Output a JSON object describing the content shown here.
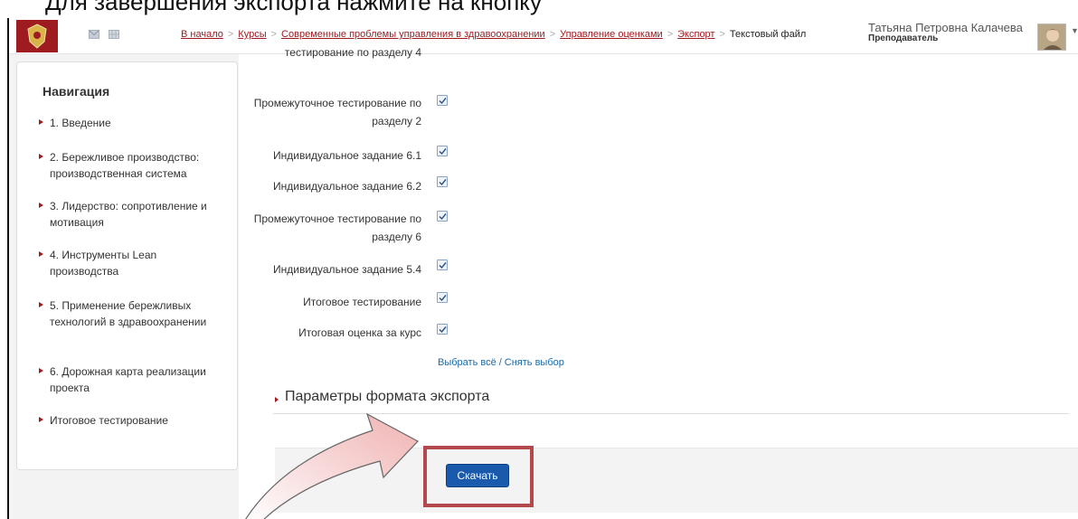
{
  "top_caption": "Для завершения экспорта нажмите на кнопку",
  "navbar": {
    "breadcrumb": [
      {
        "label": "В начало",
        "link": true
      },
      {
        "label": "Курсы",
        "link": true
      },
      {
        "label": "Современные проблемы управления в здравоохранении",
        "link": true
      },
      {
        "label": "Управление оценками",
        "link": true
      },
      {
        "label": "Экспорт",
        "link": true
      },
      {
        "label": "Текстовый файл",
        "link": false
      }
    ],
    "separator": ">",
    "user_name": "Татьяна Петровна Калачева",
    "user_role": "Преподаватель",
    "brand_color": "#9e1b20"
  },
  "sidebar": {
    "title": "Навигация",
    "items": [
      {
        "label": "1. Введение"
      },
      {
        "label": "2. Бережливое производство: производственная система"
      },
      {
        "label": "3. Лидерство: сопротивление и мотивация"
      },
      {
        "label": "4. Инструменты Lean производства"
      },
      {
        "label": "5. Применение бережливых технологий в здравоохранении"
      },
      {
        "label": "6. Дорожная карта реализации проекта"
      },
      {
        "label": "Итоговое тестирование"
      }
    ]
  },
  "grade_items": [
    {
      "label": "тестирование по разделу 4",
      "checked": true
    },
    {
      "label": "Промежуточное тестирование по разделу 2",
      "checked": true
    },
    {
      "label": "Индивидуальное задание 6.1",
      "checked": true
    },
    {
      "label": "Индивидуальное задание 6.2",
      "checked": true
    },
    {
      "label": "Промежуточное тестирование по разделу 6",
      "checked": true
    },
    {
      "label": "Индивидуальное задание 5.4",
      "checked": true
    },
    {
      "label": "Итоговое тестирование",
      "checked": true
    },
    {
      "label": "Итоговая оценка за курс",
      "checked": true
    }
  ],
  "select_all_label": "Выбрать всё",
  "deselect_label": "Снять выбор",
  "select_separator": "/",
  "export_section_title": "Параметры формата экспорта",
  "download_button": "Скачать",
  "highlight_color": "#b3484d",
  "arrow_color": "#f2b8b8"
}
